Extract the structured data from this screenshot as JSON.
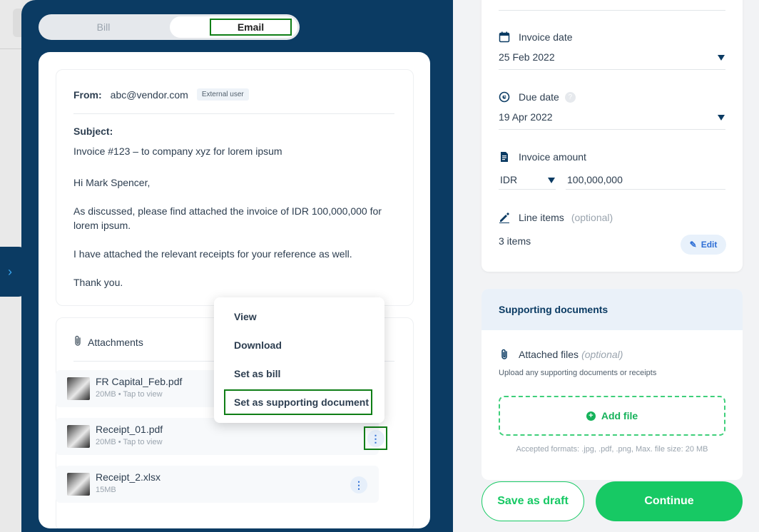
{
  "side_toggle": {
    "icon": "chevron-right-icon",
    "glyph": "›"
  },
  "tabs": {
    "bill_label": "Bill",
    "email_label": "Email",
    "active": "Email"
  },
  "email": {
    "from_label": "From:",
    "from_address": "abc@vendor.com",
    "from_badge": "External user",
    "subject_label": "Subject:",
    "subject": "Invoice #123 – to company xyz for lorem ipsum",
    "greeting": "Hi Mark Spencer,",
    "para1": "As discussed, please find attached the invoice of IDR 100,000,000 for lorem ipsum.",
    "para2": "I have attached the relevant receipts for your reference as well.",
    "signoff": "Thank you."
  },
  "attachments": {
    "title": "Attachments",
    "files": [
      {
        "name": "FR Capital_Feb.pdf",
        "meta": "20MB • Tap to view"
      },
      {
        "name": "Receipt_01.pdf",
        "meta": "20MB • Tap to view"
      },
      {
        "name": "Receipt_2.xlsx",
        "meta": "15MB"
      }
    ]
  },
  "context_menu": {
    "items": [
      "View",
      "Download",
      "Set as bill",
      "Set as supporting document"
    ],
    "highlighted": "Set as supporting document"
  },
  "form": {
    "invoice_date_label": "Invoice date",
    "invoice_date_value": "25 Feb 2022",
    "due_date_label": "Due date",
    "due_date_help": "?",
    "due_date_value": "19 Apr 2022",
    "amount_label": "Invoice amount",
    "currency": "IDR",
    "amount": "100,000,000",
    "line_items_label": "Line items",
    "line_items_optional": "(optional)",
    "line_items_count": "3 items",
    "edit_label": "Edit"
  },
  "supporting": {
    "title": "Supporting documents",
    "attached_label": "Attached files",
    "attached_optional": "(optional)",
    "hint": "Upload any supporting documents or receipts",
    "add_file_label": "Add file",
    "formats": "Accepted formats: .jpg, .pdf, .png, Max. file size: 20 MB"
  },
  "actions": {
    "save_draft": "Save as draft",
    "continue": "Continue"
  },
  "colors": {
    "navy": "#0b3b63",
    "green": "#17c964",
    "highlight_border": "#0f7e16",
    "link_blue": "#2f6fd6"
  }
}
